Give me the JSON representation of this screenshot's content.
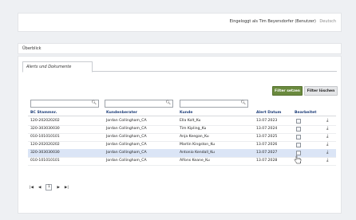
{
  "header": {
    "user_text": "Eingeloggt als Tim Beyersdorfer (Benutzer)",
    "language": "Deutsch"
  },
  "overview": {
    "title": "Überblick"
  },
  "tabs": [
    {
      "label": "Alerts und Dokumente"
    }
  ],
  "buttons": {
    "set_filter": "Filter setzen",
    "clear_filter": "Filter löschen"
  },
  "filters": {
    "bc_value": "",
    "kundenberater_value": "",
    "kunde_value": ""
  },
  "table": {
    "columns": [
      "BC Stammnr.",
      "Kundenberater",
      "Kunde",
      "Alert Datum",
      "Bearbeitet"
    ],
    "rows": [
      {
        "bc": "120-202020202",
        "kundenberater": "Jordan Collingham_CA",
        "kunde": "Ella Kolt_Ku",
        "datum": "13.07.2023"
      },
      {
        "bc": "320-303030030",
        "kundenberater": "Jordan Collingham_CA",
        "kunde": "Tim Kipling_Ku",
        "datum": "13.07.2024"
      },
      {
        "bc": "010-101010101",
        "kundenberater": "Jordan Collingham_CA",
        "kunde": "Anja Keegan_Ku",
        "datum": "13.07.2025"
      },
      {
        "bc": "120-202020202",
        "kundenberater": "Jordan Collingham_CA",
        "kunde": "Martin Kingston_Ku",
        "datum": "13.07.2026"
      },
      {
        "bc": "320-303030030",
        "kundenberater": "Jordan Collingham_CA",
        "kunde": "Antonio Kendall_Ku",
        "datum": "13.07.2027"
      },
      {
        "bc": "010-101010101",
        "kundenberater": "Jordan Collingham_CA",
        "kunde": "Alfons Keane_Ku",
        "datum": "13.07.2028"
      }
    ],
    "selected_row": 4
  },
  "pager": {
    "first": "⏮",
    "prev": "◀",
    "current_page": "1",
    "next": "▶",
    "last": "⏭"
  },
  "icons": {
    "search": "search-icon",
    "download": "download-icon",
    "checkbox": "checkbox-icon"
  },
  "colors": {
    "accent_green": "#6a8a3e",
    "header_blue": "#1f3f7a",
    "selected_row": "#dbe5f6"
  }
}
